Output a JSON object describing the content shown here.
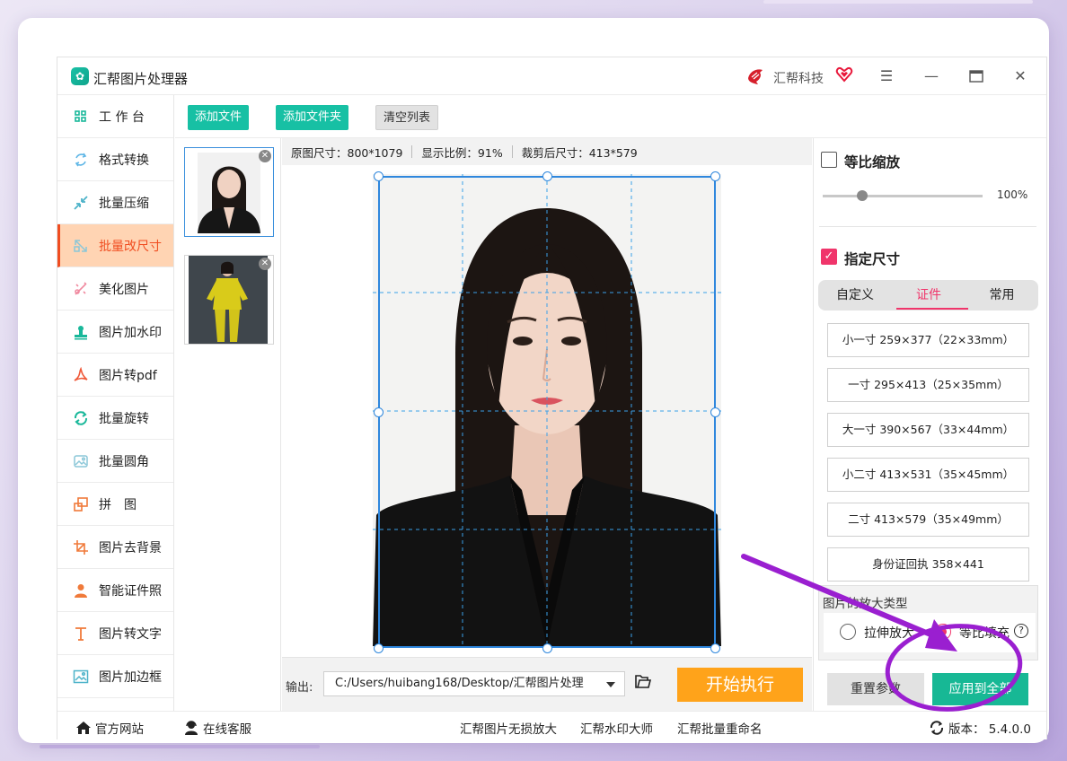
{
  "app": {
    "title": "汇帮图片处理器",
    "brand": "汇帮科技",
    "logo_icon": "app-logo-icon",
    "window_controls": [
      "menu-icon",
      "minimize-icon",
      "maximize-icon",
      "close-icon"
    ]
  },
  "sidebar": {
    "items": [
      {
        "label": "工 作 台",
        "icon": "dashboard-icon",
        "active": false
      },
      {
        "label": "格式转换",
        "icon": "convert-icon",
        "active": false
      },
      {
        "label": "批量压缩",
        "icon": "compress-icon",
        "active": false
      },
      {
        "label": "批量改尺寸",
        "icon": "resize-icon",
        "active": true
      },
      {
        "label": "美化图片",
        "icon": "beautify-icon",
        "active": false
      },
      {
        "label": "图片加水印",
        "icon": "watermark-icon",
        "active": false
      },
      {
        "label": "图片转pdf",
        "icon": "pdf-icon",
        "active": false
      },
      {
        "label": "批量旋转",
        "icon": "rotate-icon",
        "active": false
      },
      {
        "label": "批量圆角",
        "icon": "round-corner-icon",
        "active": false
      },
      {
        "label": "拼　图",
        "icon": "collage-icon",
        "active": false
      },
      {
        "label": "图片去背景",
        "icon": "crop-icon",
        "active": false
      },
      {
        "label": "智能证件照",
        "icon": "id-photo-icon",
        "active": false
      },
      {
        "label": "图片转文字",
        "icon": "text-icon",
        "active": false
      },
      {
        "label": "图片加边框",
        "icon": "frame-icon",
        "active": false
      }
    ]
  },
  "toolbar": {
    "add_file": "添加文件",
    "add_folder": "添加文件夹",
    "clear_list": "清空列表"
  },
  "info": {
    "orig_size": "原图尺寸：800*1079",
    "scale": "显示比例：91%",
    "crop_size": "裁剪后尺寸：413*579"
  },
  "output": {
    "label": "输出:",
    "path": "C:/Users/huibang168/Desktop/汇帮图片处理",
    "start": "开始执行"
  },
  "right_panel": {
    "proportional": {
      "label": "等比缩放",
      "checked": false,
      "percent_text": "100%",
      "slider_fraction": 0.25
    },
    "specified": {
      "label": "指定尺寸",
      "checked": true
    },
    "tabs": [
      {
        "label": "自定义",
        "active": false
      },
      {
        "label": "证件",
        "active": true
      },
      {
        "label": "常用",
        "active": false
      }
    ],
    "sizes": [
      "小一寸 259×377（22×33mm）",
      "一寸 295×413（25×35mm）",
      "大一寸 390×567（33×44mm）",
      "小二寸 413×531（35×45mm）",
      "二寸 413×579（35×49mm）",
      "身份证回执 358×441"
    ],
    "zoom_type": {
      "title": "图片的放大类型",
      "options": [
        {
          "label": "拉伸放大",
          "selected": false
        },
        {
          "label": "等比填充",
          "selected": true
        }
      ]
    },
    "reset": "重置参数",
    "apply_all": "应用到全部"
  },
  "footer": {
    "website": "官方网站",
    "support": "在线客服",
    "link1": "汇帮图片无损放大",
    "link2": "汇帮水印大师",
    "link3": "汇帮批量重命名",
    "version": "版本：  5.4.0.0"
  },
  "colors": {
    "accent_green": "#17c0a4",
    "active_orange": "#f04d20",
    "pink": "#f0356b",
    "start_orange": "#ffa31a",
    "annotation_purple": "#9a1fd0"
  }
}
